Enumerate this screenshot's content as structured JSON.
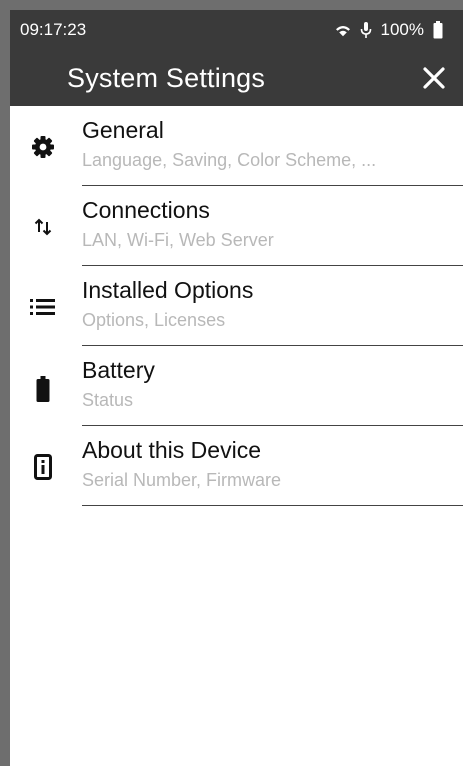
{
  "status_bar": {
    "time": "09:17:23",
    "battery_percent": "100%",
    "icons": [
      "wifi-icon",
      "microphone-icon",
      "battery-icon"
    ]
  },
  "app_bar": {
    "title": "System Settings",
    "close_icon": "close-icon"
  },
  "settings": [
    {
      "icon": "gear-icon",
      "title": "General",
      "subtitle": "Language, Saving, Color Scheme, ..."
    },
    {
      "icon": "up-down-arrows-icon",
      "title": "Connections",
      "subtitle": "LAN, Wi-Fi, Web Server"
    },
    {
      "icon": "list-icon",
      "title": "Installed Options",
      "subtitle": "Options, Licenses"
    },
    {
      "icon": "battery-icon",
      "title": "Battery",
      "subtitle": "Status"
    },
    {
      "icon": "device-info-icon",
      "title": "About this Device",
      "subtitle": "Serial Number, Firmware"
    }
  ],
  "colors": {
    "bar_background": "#3a3a3a",
    "content_background": "#ffffff",
    "primary_text": "#111111",
    "secondary_text": "#b8b8b8",
    "divider": "#444444"
  }
}
